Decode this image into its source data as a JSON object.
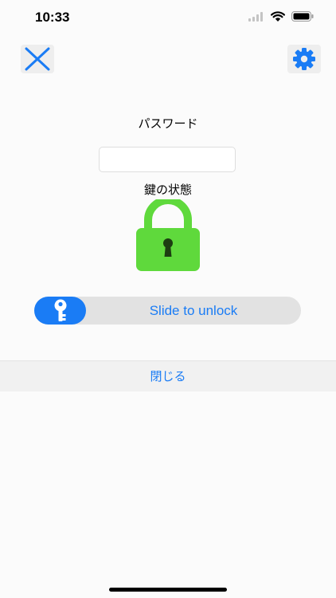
{
  "status_bar": {
    "time": "10:33",
    "signal_icon": "cellular-signal-icon",
    "wifi_icon": "wifi-icon",
    "battery_icon": "battery-icon"
  },
  "toolbar": {
    "close_icon": "close-x-icon",
    "settings_icon": "gear-icon"
  },
  "password": {
    "label": "パスワード",
    "value": "",
    "placeholder": ""
  },
  "lock_status": {
    "label": "鍵の状態",
    "icon": "padlock-locked-icon",
    "color": "#5fd93c"
  },
  "slider": {
    "label": "Slide to unlock",
    "knob_icon": "key-icon",
    "accent": "#1a7cf5"
  },
  "footer": {
    "close_label": "閉じる"
  }
}
